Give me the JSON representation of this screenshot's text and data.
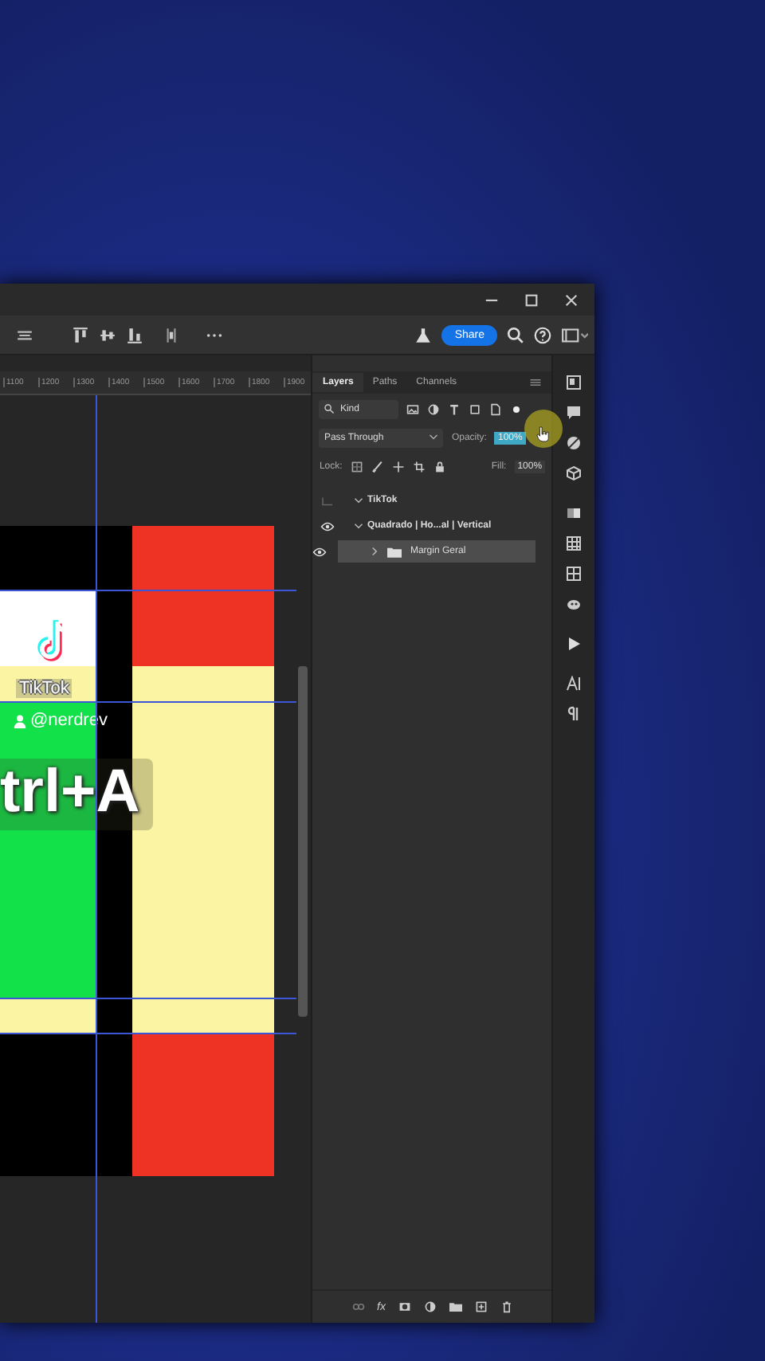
{
  "share_button": {
    "label": "Share"
  },
  "ruler": {
    "labels": [
      "1100",
      "1200",
      "1300",
      "1400",
      "1500",
      "1600",
      "1700",
      "1800",
      "1900"
    ]
  },
  "canvas": {
    "logo_text": "TikTok",
    "handle": "@nerdrev",
    "caption": "trl+A"
  },
  "layers_panel": {
    "tabs": [
      {
        "label": "Layers",
        "selected": true
      },
      {
        "label": "Paths",
        "selected": false
      },
      {
        "label": "Channels",
        "selected": false
      }
    ],
    "filter": "Kind",
    "blend_mode": "Pass Through",
    "opacity_label": "Opacity:",
    "opacity": "100%",
    "lock_label": "Lock:",
    "fill_label": "Fill:",
    "fill": "100%",
    "style_button": "fx",
    "layers": [
      {
        "name": "TikTok",
        "visible": false,
        "expanded": true,
        "selected": false
      },
      {
        "name": "Quadrado | Ho...al | Vertical",
        "visible": true,
        "expanded": true,
        "selected": false,
        "children": [
          {
            "name": "Margin Geral",
            "visible": true,
            "expanded": false,
            "selected": true
          }
        ]
      }
    ]
  }
}
